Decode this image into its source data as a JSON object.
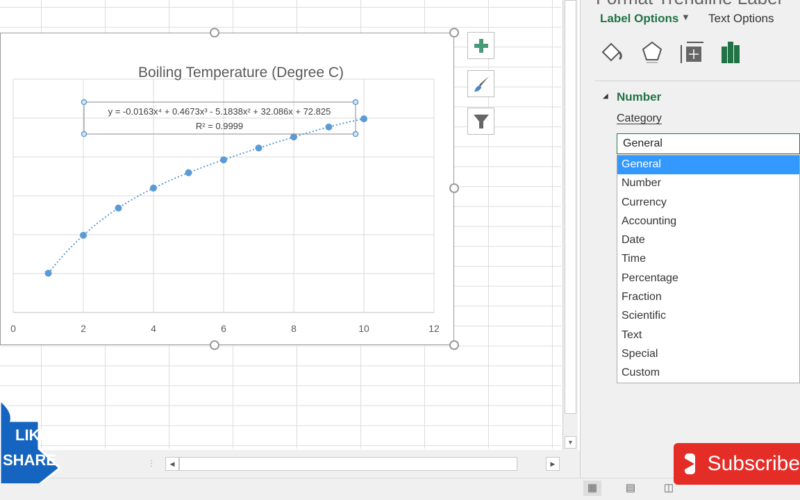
{
  "chart_data": {
    "type": "scatter",
    "title": "Boiling Temperature (Degree C)",
    "x": [
      1,
      2,
      3,
      4,
      5,
      6,
      7,
      8,
      9,
      10
    ],
    "y": [
      100.2,
      119.7,
      133.7,
      144.0,
      151.9,
      158.5,
      164.6,
      170.3,
      175.4,
      179.6
    ],
    "xlim": [
      0,
      12
    ],
    "ylim": [
      80,
      200
    ],
    "xticks": [
      "0",
      "2",
      "4",
      "6",
      "8",
      "10",
      "12"
    ],
    "grid": true,
    "series_color": "#5b9bd5",
    "trendline": {
      "type": "polynomial",
      "order": 4,
      "style": "dotted",
      "equation": "y = -0.0163x⁴ + 0.4673x³ - 5.1838x² + 32.086x + 72.825",
      "r2": "R² = 0.9999",
      "coefficients": [
        -0.0163,
        0.4673,
        -5.1838,
        32.086,
        72.825
      ]
    }
  },
  "chart_buttons": [
    {
      "icon": "plus-icon"
    },
    {
      "icon": "brush-icon"
    },
    {
      "icon": "filter-icon"
    }
  ],
  "panel": {
    "title": "Format Trendline Label",
    "tabs": [
      "Label Options",
      "Text Options"
    ],
    "icons": [
      "fill-line-icon",
      "effects-icon",
      "size-properties-icon",
      "label-options-icon"
    ],
    "section": "Number",
    "category_label": "Category",
    "category_value": "General",
    "options": [
      "General",
      "Number",
      "Currency",
      "Accounting",
      "Date",
      "Time",
      "Percentage",
      "Fraction",
      "Scientific",
      "Text",
      "Special",
      "Custom"
    ],
    "accent": "#217346"
  },
  "overlay": {
    "like": "LIKE",
    "share": "SHARE",
    "subscribe": "Subscribe"
  }
}
